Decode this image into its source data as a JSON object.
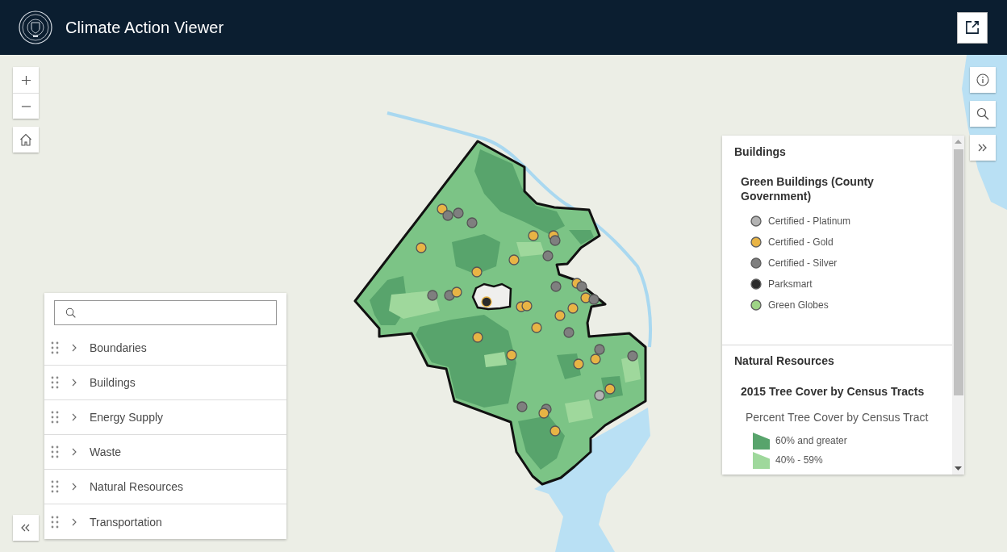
{
  "header": {
    "title": "Climate Action Viewer"
  },
  "layer_list": {
    "items": [
      {
        "label": "Boundaries",
        "expanded": false
      },
      {
        "label": "Buildings",
        "expanded": false
      },
      {
        "label": "Energy Supply",
        "expanded": false
      },
      {
        "label": "Waste",
        "expanded": false
      },
      {
        "label": "Natural Resources",
        "expanded": false
      },
      {
        "label": "Transportation",
        "expanded": false
      }
    ]
  },
  "legend": {
    "sections": [
      {
        "title": "Buildings",
        "layers": [
          {
            "title": "Green Buildings (County Government)",
            "items": [
              {
                "label": "Certified - Platinum",
                "kind": "point",
                "color": "#b3b3b3"
              },
              {
                "label": "Certified - Gold",
                "kind": "point",
                "color": "#e8b445"
              },
              {
                "label": "Certified - Silver",
                "kind": "point",
                "color": "#7f7f7f"
              },
              {
                "label": "Parksmart",
                "kind": "point",
                "color": "#2b2b2b"
              },
              {
                "label": "Green Globes",
                "kind": "point",
                "color": "#9ed486"
              }
            ]
          }
        ]
      },
      {
        "title": "Natural Resources",
        "layers": [
          {
            "title": "2015 Tree Cover by Census Tracts",
            "subtitle": "Percent Tree Cover by Census Tract",
            "items": [
              {
                "label": "60% and greater",
                "kind": "polygon",
                "color": "#58a46c"
              },
              {
                "label": "40% - 59%",
                "kind": "polygon",
                "color": "#9fd89c"
              }
            ]
          }
        ]
      }
    ]
  }
}
